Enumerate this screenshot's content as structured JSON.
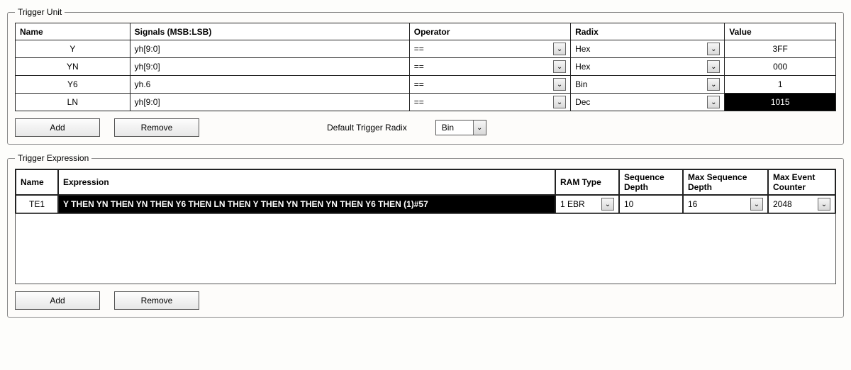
{
  "trigger_unit": {
    "legend": "Trigger Unit",
    "headers": {
      "name": "Name",
      "signals": "Signals (MSB:LSB)",
      "operator": "Operator",
      "radix": "Radix",
      "value": "Value"
    },
    "rows": [
      {
        "name": "Y",
        "signals": "yh[9:0]",
        "operator": "==",
        "radix": "Hex",
        "value": "3FF",
        "inverted": false
      },
      {
        "name": "YN",
        "signals": "yh[9:0]",
        "operator": "==",
        "radix": "Hex",
        "value": "000",
        "inverted": false
      },
      {
        "name": "Y6",
        "signals": "yh.6",
        "operator": "==",
        "radix": "Bin",
        "value": "1",
        "inverted": false
      },
      {
        "name": "LN",
        "signals": "yh[9:0]",
        "operator": "==",
        "radix": "Dec",
        "value": "1015",
        "inverted": true
      }
    ],
    "add_label": "Add",
    "remove_label": "Remove",
    "default_radix_label": "Default Trigger Radix",
    "default_radix_value": "Bin"
  },
  "trigger_expr": {
    "legend": "Trigger Expression",
    "headers": {
      "name": "Name",
      "expression": "Expression",
      "ram_type": "RAM Type",
      "seq_depth": "Sequence Depth",
      "max_seq_depth": "Max Sequence Depth",
      "max_event_counter": "Max Event Counter"
    },
    "row": {
      "name": "TE1",
      "expression": "Y THEN YN THEN YN THEN Y6 THEN LN THEN Y THEN YN THEN YN THEN Y6 THEN (1)#57",
      "ram_type": "1 EBR",
      "seq_depth": "10",
      "max_seq_depth": "16",
      "max_event_counter": "2048"
    },
    "add_label": "Add",
    "remove_label": "Remove"
  }
}
